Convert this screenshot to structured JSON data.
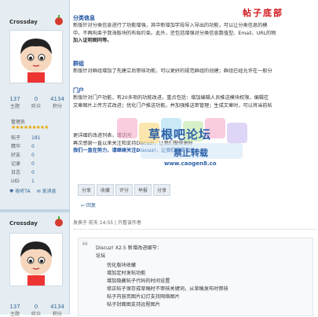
{
  "sidebar": {
    "users": [
      {
        "name": "Crossday",
        "stats": [
          {
            "value": "137",
            "label": "主题"
          },
          {
            "value": "0",
            "label": "听众"
          },
          {
            "value": "4134",
            "label": "积分"
          }
        ],
        "role": "管理员",
        "profile": [
          {
            "k": "帖子",
            "v": "181"
          },
          {
            "k": "精华",
            "v": "0"
          },
          {
            "k": "好友",
            "v": "0"
          },
          {
            "k": "记录",
            "v": "0"
          },
          {
            "k": "日志",
            "v": "0"
          },
          {
            "k": "UID",
            "v": "1"
          }
        ],
        "actions": [
          "收听TA",
          "发消息"
        ]
      },
      {
        "name": "Crossday",
        "stats": [
          {
            "value": "137",
            "label": "主题"
          },
          {
            "value": "0",
            "label": "听众"
          },
          {
            "value": "4134",
            "label": "积分"
          }
        ]
      }
    ]
  },
  "post1": {
    "stamp": "帖子底部",
    "sections": [
      {
        "title": "分类信息",
        "lines": [
          "新版针对分类信息进行了功能增强，其中新增加字段导入导出的功能，可以让分类信息的模",
          "中，不再拘束于我海版块的布局约束。此外，还包括增强对分类信息数值型、Email、URL的物",
          "加入证明图同等。"
        ]
      },
      {
        "title": "群组",
        "lines": [
          "新版针对群组增加了先建立后审核功能，可以更好的规范群组的创建；群组已经允许在一般分"
        ]
      },
      {
        "title": "门户",
        "lines": [
          "新版针对门户功能，有20多项的功能改进，重点包括：增加编辑人员推送模块权限，编辑在",
          "文章图片上传方式改进；优化门户推送功能，并加强推送审管理；生成文章时，可以将当前帖"
        ]
      }
    ],
    "more_lines": [
      "更详细的改进列表，请访问",
      "再次感谢一直以来关注和支持Discuz!，让我们做得更好",
      "我们一直在努力，请继续关注Discuz!，让我们做得更好→"
    ],
    "watermark": {
      "line1": "草根吧论坛",
      "line2": "禁止转载",
      "line3": "www.caogen8.co"
    },
    "toolbar": [
      "分享",
      "收藏",
      "评分",
      "举报",
      "分享"
    ],
    "reply": "回复"
  },
  "post2": {
    "meta": "发表于 前天 14:55 | 只看该作者",
    "quote": {
      "title": "Discuz! X2.5 新增改进细节：",
      "sub": "论坛",
      "items": [
        "优化版块收藏",
        "增加定时发帖功能",
        "增加隐藏帖子代码的时间设置",
        "修正帖子保存成草稿时不审核关键词，从草稿发布时审核",
        "帖子内容页图片幻灯支持网络图片",
        "帖子封面图支持远程图片"
      ]
    }
  }
}
